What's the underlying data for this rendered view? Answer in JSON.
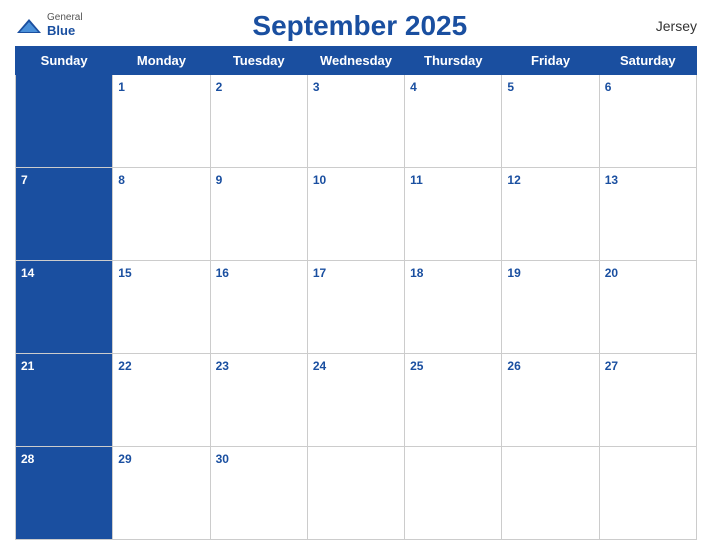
{
  "header": {
    "title": "September 2025",
    "location": "Jersey",
    "logo_general": "General",
    "logo_blue": "Blue"
  },
  "days_of_week": [
    "Sunday",
    "Monday",
    "Tuesday",
    "Wednesday",
    "Thursday",
    "Friday",
    "Saturday"
  ],
  "weeks": [
    [
      null,
      1,
      2,
      3,
      4,
      5,
      6
    ],
    [
      7,
      8,
      9,
      10,
      11,
      12,
      13
    ],
    [
      14,
      15,
      16,
      17,
      18,
      19,
      20
    ],
    [
      21,
      22,
      23,
      24,
      25,
      26,
      27
    ],
    [
      28,
      29,
      30,
      null,
      null,
      null,
      null
    ]
  ],
  "blue_cells": [
    0,
    7,
    14,
    21,
    28
  ]
}
